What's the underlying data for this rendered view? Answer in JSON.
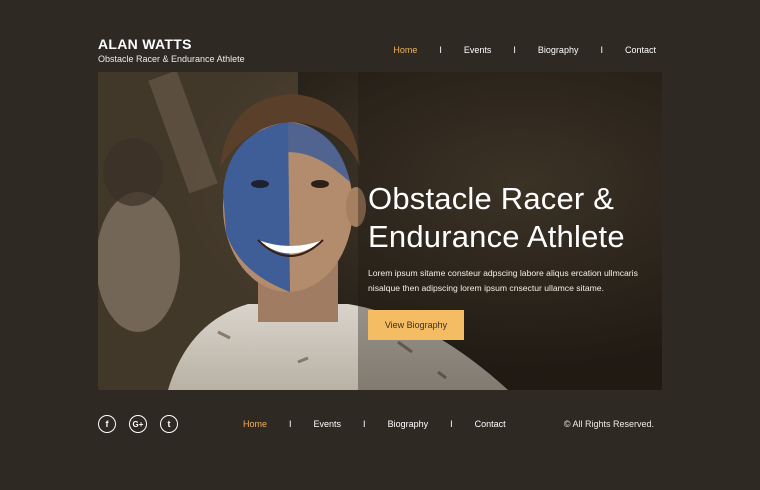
{
  "brand": {
    "name": "ALAN WATTS",
    "tagline": "Obstacle Racer & Endurance Athlete"
  },
  "nav": {
    "items": [
      {
        "label": "Home",
        "active": true
      },
      {
        "label": "Events",
        "active": false
      },
      {
        "label": "Biography",
        "active": false
      },
      {
        "label": "Contact",
        "active": false
      }
    ],
    "separator": "I"
  },
  "hero": {
    "title_line1": "Obstacle Racer &",
    "title_line2": "Endurance Athlete",
    "text": "Lorem ipsum sitame consteur adpscing labore aliqus ercation ullmcaris nisalque then adipscing lorem ipsum cnsectur ullamce sitame.",
    "button_label": "View Biography"
  },
  "footer": {
    "social": [
      {
        "icon": "facebook-icon",
        "glyph": "f"
      },
      {
        "icon": "google-plus-icon",
        "glyph": "G+"
      },
      {
        "icon": "twitter-icon",
        "glyph": "t"
      }
    ],
    "nav": [
      {
        "label": "Home",
        "active": true
      },
      {
        "label": "Events",
        "active": false
      },
      {
        "label": "Biography",
        "active": false
      },
      {
        "label": "Contact",
        "active": false
      }
    ],
    "copyright": "© All Rights Reserved."
  },
  "colors": {
    "background": "#2e2923",
    "accent": "#f2b156",
    "button": "#f5bd63"
  }
}
